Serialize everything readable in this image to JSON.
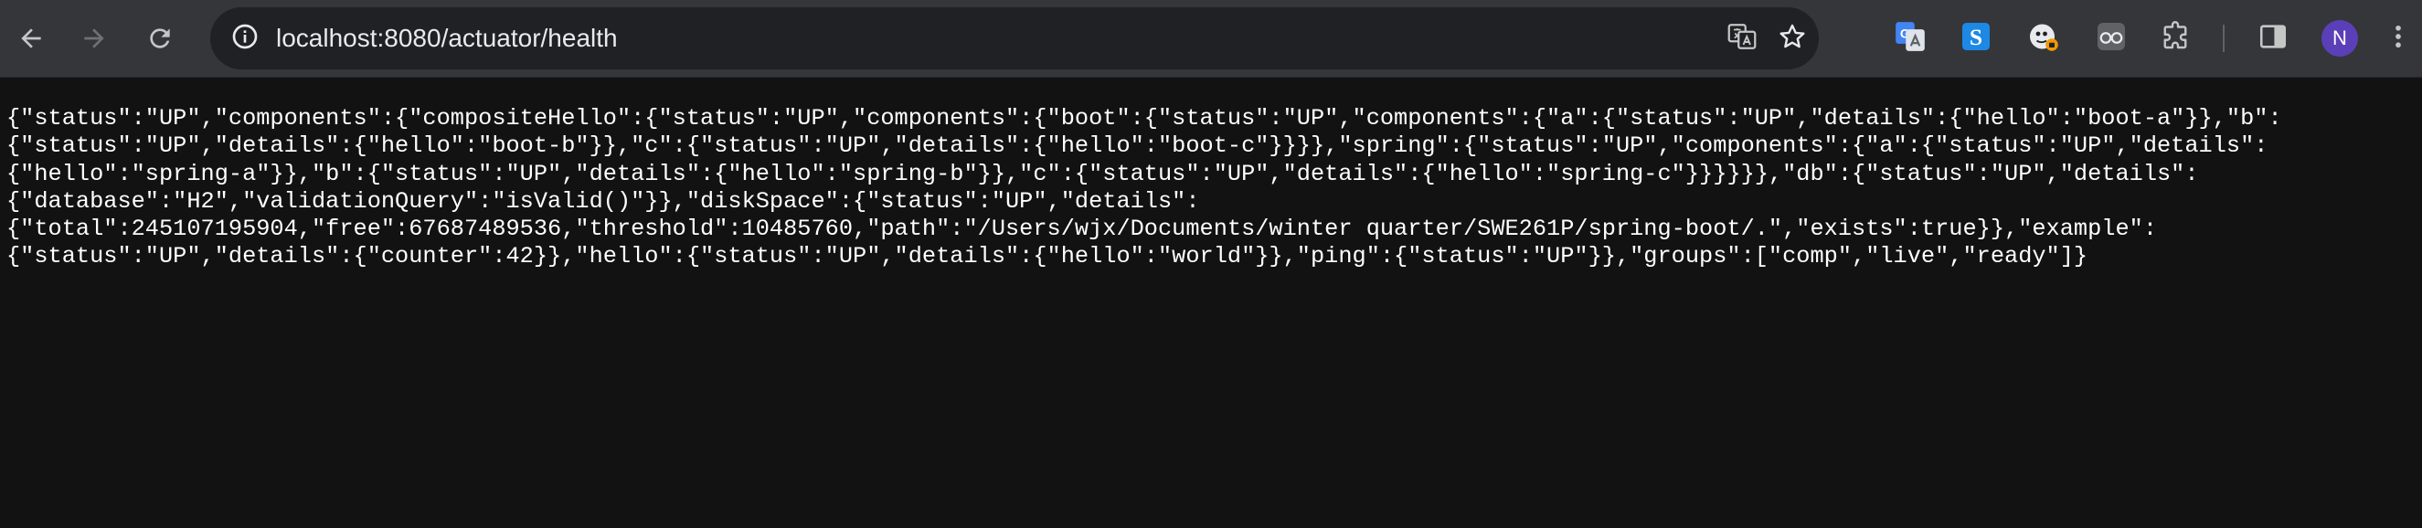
{
  "toolbar": {
    "url": "localhost:8080/actuator/health",
    "avatar_initial": "N",
    "accent_color": "#5b3fb8"
  },
  "icons": {
    "back": "arrow-left-icon",
    "forward": "arrow-right-icon",
    "reload": "reload-icon",
    "site_info": "info-circle-icon",
    "translate": "translate-icon",
    "bookmark": "star-icon",
    "extensions": [
      "google-translate-extension-icon",
      "s-extension-icon",
      "mascot-extension-icon",
      "glasses-extension-icon",
      "puzzle-extensions-icon"
    ],
    "side_panel": "side-panel-icon",
    "menu": "vertical-dots-menu-icon"
  },
  "response": {
    "lines": [
      "{\"status\":\"UP\",\"components\":{\"compositeHello\":{\"status\":\"UP\",\"components\":{\"boot\":{\"status\":\"UP\",\"components\":{\"a\":{\"status\":\"UP\",\"details\":{\"hello\":\"boot-a\"}},\"b\":",
      "{\"status\":\"UP\",\"details\":{\"hello\":\"boot-b\"}},\"c\":{\"status\":\"UP\",\"details\":{\"hello\":\"boot-c\"}}}},\"spring\":{\"status\":\"UP\",\"components\":{\"a\":{\"status\":\"UP\",\"details\":",
      "{\"hello\":\"spring-a\"}},\"b\":{\"status\":\"UP\",\"details\":{\"hello\":\"spring-b\"}},\"c\":{\"status\":\"UP\",\"details\":{\"hello\":\"spring-c\"}}}}}},\"db\":{\"status\":\"UP\",\"details\":",
      "{\"database\":\"H2\",\"validationQuery\":\"isValid()\"}},\"diskSpace\":{\"status\":\"UP\",\"details\":",
      "{\"total\":245107195904,\"free\":67687489536,\"threshold\":10485760,\"path\":\"/Users/wjx/Documents/winter quarter/SWE261P/spring-boot/.\",\"exists\":true}},\"example\":",
      "{\"status\":\"UP\",\"details\":{\"counter\":42}},\"hello\":{\"status\":\"UP\",\"details\":{\"hello\":\"world\"}},\"ping\":{\"status\":\"UP\"}},\"groups\":[\"comp\",\"live\",\"ready\"]}"
    ]
  }
}
